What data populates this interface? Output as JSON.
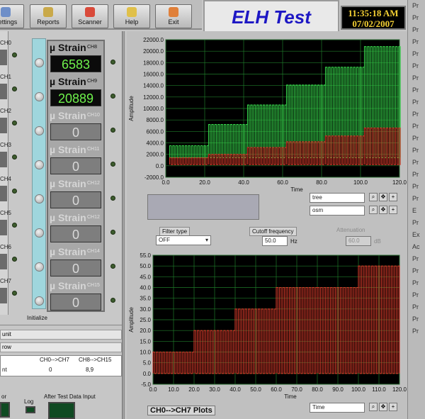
{
  "toolbar": {
    "buttons": [
      {
        "label": "Settings",
        "icon": "settings-icon",
        "color": "#6f8fc8"
      },
      {
        "label": "Reports",
        "icon": "reports-icon",
        "color": "#c9a94a"
      },
      {
        "label": "Scanner",
        "icon": "scanner-icon",
        "color": "#d94a3a"
      },
      {
        "label": "Help",
        "icon": "help-icon",
        "color": "#e0c04a"
      },
      {
        "label": "Exit",
        "icon": "exit-icon",
        "color": "#e0803a"
      }
    ]
  },
  "header": {
    "title": "ELH  Test",
    "time": "11:35:18 AM",
    "date": "07/02/2007"
  },
  "left_channels": [
    "CH0",
    "CH1",
    "CH2",
    "CH3",
    "CH4",
    "CH5",
    "CH6",
    "CH7"
  ],
  "strain": {
    "label": "µ Strain",
    "rows": [
      {
        "channel": "CH8",
        "value": "6583",
        "active": true
      },
      {
        "channel": "CH9",
        "value": "20889",
        "active": true
      },
      {
        "channel": "CH10",
        "value": "0",
        "active": false
      },
      {
        "channel": "CH11",
        "value": "0",
        "active": false
      },
      {
        "channel": "CH12",
        "value": "0",
        "active": false
      },
      {
        "channel": "CH12",
        "value": "0",
        "active": false
      },
      {
        "channel": "CH14",
        "value": "0",
        "active": false
      },
      {
        "channel": "CH15",
        "value": "0",
        "active": false
      }
    ]
  },
  "initialize_label": "Initialize",
  "bottom_left": {
    "unit_label": "unit",
    "row_label": "row",
    "table_headers": [
      "CH0-->CH7",
      "CH8-->CH15"
    ],
    "table_values": [
      "0",
      "8,9"
    ],
    "table_row_label": "nt",
    "log_label": "Log",
    "after_test_label": "After Test Data Input",
    "or_label": "or"
  },
  "chart_top": {
    "legend_items": [
      "tree",
      "osm"
    ],
    "filter_type_label": "Filter type",
    "filter_type_value": "OFF",
    "cutoff_label": "Cutoff frequency",
    "cutoff_value": "50.0",
    "cutoff_unit": "Hz",
    "attenuation_label": "Attenuation",
    "attenuation_value": "60.0",
    "attenuation_unit": "dB"
  },
  "chart_bottom": {
    "plot_label": "CH0-->CH7 Plots",
    "time_field": "Time"
  },
  "right_strip": [
    "Pr",
    "Pr",
    "Pr",
    "Pr",
    "Pr",
    "Pr",
    "Pr",
    "Pr",
    "Pr",
    "Pr",
    "Pr",
    "Pr",
    "Pr",
    "Pr",
    "Pr",
    "Pr",
    "Pr",
    "E",
    "Pr",
    "Ex",
    "Ac",
    "Pr",
    "Pr",
    "Pr",
    "Pr",
    "Pr",
    "Pr",
    "Pr"
  ],
  "chart_data": [
    {
      "type": "line",
      "xlabel": "Time",
      "ylabel": "Amplitude",
      "xlim": [
        0,
        120
      ],
      "ylim": [
        -2000,
        22000
      ],
      "xticks": [
        0.0,
        20.0,
        40.0,
        60.0,
        80.0,
        100.0,
        120.0
      ],
      "yticks": [
        -2000,
        0,
        2000,
        4000,
        6000,
        8000,
        10000,
        12000,
        14000,
        16000,
        18000,
        20000,
        22000
      ],
      "grid": true,
      "background": "#000000",
      "series": [
        {
          "color": "#36d44a",
          "steps": [
            [
              2,
              22,
              1400,
              3500
            ],
            [
              22,
              42,
              1400,
              7200
            ],
            [
              42,
              62,
              1400,
              10600
            ],
            [
              62,
              82,
              1400,
              14100
            ],
            [
              82,
              102,
              1400,
              17200
            ],
            [
              102,
              120,
              1400,
              20800
            ]
          ]
        },
        {
          "color": "#d43a2a",
          "steps": [
            [
              2,
              22,
              200,
              1400
            ],
            [
              22,
              42,
              200,
              2000
            ],
            [
              42,
              62,
              200,
              3200
            ],
            [
              62,
              82,
              200,
              4200
            ],
            [
              82,
              102,
              200,
              5200
            ],
            [
              102,
              120,
              200,
              6600
            ]
          ]
        }
      ]
    },
    {
      "type": "line",
      "xlabel": "Time",
      "ylabel": "Amplitude",
      "xlim": [
        0,
        120
      ],
      "ylim": [
        -5,
        55
      ],
      "xticks": [
        0.0,
        10.0,
        20.0,
        30.0,
        40.0,
        50.0,
        60.0,
        70.0,
        80.0,
        90.0,
        100.0,
        110.0,
        120.0
      ],
      "yticks": [
        -5.0,
        0.0,
        5.0,
        10.0,
        15.0,
        20.0,
        25.0,
        30.0,
        35.0,
        40.0,
        45.0,
        50.0,
        55.0
      ],
      "grid": true,
      "background": "#000000",
      "series": [
        {
          "color": "#d43a2a",
          "steps": [
            [
              0,
              20,
              0,
              10
            ],
            [
              20,
              40,
              0,
              20
            ],
            [
              40,
              60,
              0,
              30
            ],
            [
              60,
              80,
              0,
              40
            ],
            [
              80,
              100,
              0,
              40
            ],
            [
              100,
              120,
              0,
              50
            ]
          ]
        }
      ]
    }
  ]
}
